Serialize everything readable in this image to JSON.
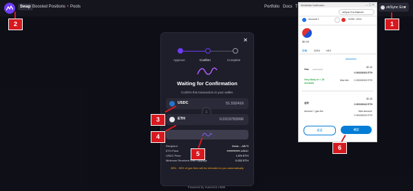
{
  "nav": {
    "swap": "Swap",
    "boosted": "Boosted Positions",
    "boosted_badge": "+",
    "pools": "Pools",
    "portfolio": "Portfolio",
    "docs": "Docs",
    "network_label": "zkSync Era",
    "right_trunc": "T"
  },
  "markers": [
    "1",
    "2",
    "3",
    "4",
    "5",
    "6"
  ],
  "modal": {
    "steps": [
      "Approve",
      "Confirm",
      "Complete"
    ],
    "title": "Waiting for Confirmation",
    "subtitle": "Confirm this transaction in your wallet.",
    "from_token": "USDC",
    "from_amount": "51.592416",
    "to_token": "ETH",
    "to_amount": "0.0319783996",
    "info": [
      {
        "k": "Recipient",
        "v": "0xfae....AB73"
      },
      {
        "k": "ETH Price",
        "v_old": "0.0001993",
        "v": "USDC"
      },
      {
        "k": "USDC Price",
        "v": "1.6% ETH"
      },
      {
        "k": "Minimum Received With Slippage",
        "v": "0.032 ETH"
      }
    ],
    "refund": "38% - 98% of gas fees will be refunded to you automatically",
    "powered": "Powered by maverick AMM"
  },
  "metamask": {
    "window_title": "MetaMask Notification",
    "network": "zkSync Era Mainnet",
    "account": "Account 1",
    "to_address": "0x39f...2314",
    "amount": "$0.00",
    "tabs": [
      "詳情",
      "DATA",
      "HEX"
    ],
    "advanced": "Advanced",
    "gas_label": "Gas",
    "gas_est": "(estimated)",
    "gas_usd": "$0.42",
    "gas_eth": "0.00026263 ETH",
    "likely": "Very likely in < 15 seconds",
    "max_fee_label": "Max fee:",
    "max_fee": "0.00026263 ETH",
    "total_usd": "$0.46",
    "total_label": "合計",
    "total_eth": "0.00026343 ETH",
    "amount_gas_label": "Amount + gas fee",
    "max_amount_label": "Max amount:",
    "max_amount": "0.00026343 ETH",
    "reject": "拒否",
    "confirm": "確認"
  }
}
